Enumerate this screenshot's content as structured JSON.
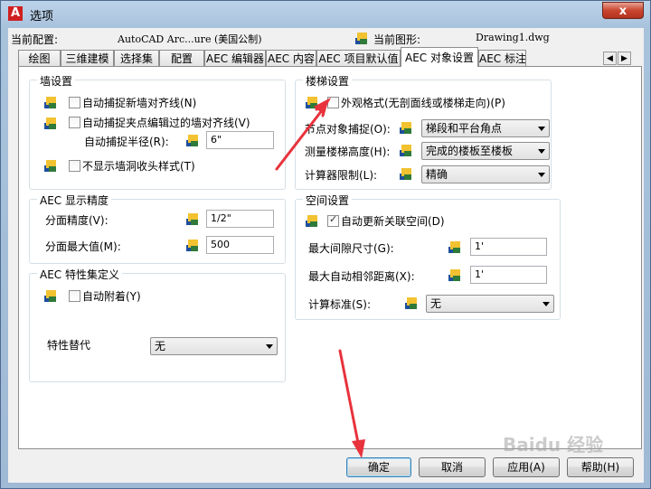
{
  "window": {
    "title": "选项",
    "app_icon": "A"
  },
  "profile": {
    "current_profile_label": "当前配置:",
    "current_profile_value": "AutoCAD Arc...ure (美国公制)",
    "current_drawing_label": "当前图形:",
    "current_drawing_value": "Drawing1.dwg"
  },
  "tabs": [
    "绘图",
    "三维建模",
    "选择集",
    "配置",
    "AEC 编辑器",
    "AEC 内容",
    "AEC 项目默认值",
    "AEC 对象设置",
    "AEC 标注"
  ],
  "active_tab": "AEC 对象设置",
  "wall": {
    "title": "墙设置",
    "autosnap_new": "自动捕捉新墙对齐线(N)",
    "autosnap_grip": "自动捕捉夹点编辑过的墙对齐线(V)",
    "radius_label": "自动捕捉半径(R):",
    "radius_value": "6\"",
    "no_cleanup": "不显示墙洞收头样式(T)"
  },
  "precision": {
    "title": "AEC 显示精度",
    "area_label": "分面精度(V):",
    "area_value": "1/2\"",
    "max_label": "分面最大值(M):",
    "max_value": "500"
  },
  "propset": {
    "title": "AEC 特性集定义",
    "auto_attach": "自动附着(Y)",
    "override_label": "特性替代",
    "override_value": "无"
  },
  "stair": {
    "title": "楼梯设置",
    "presentation": "外观格式(无剖面线或楼梯走向)(P)",
    "snap_label": "节点对象捕捉(O):",
    "snap_value": "梯段和平台角点",
    "measure_label": "测量楼梯高度(H):",
    "measure_value": "完成的楼板至楼板",
    "calc_label": "计算器限制(L):",
    "calc_value": "精确"
  },
  "space": {
    "title": "空间设置",
    "auto_update": "自动更新关联空间(D)",
    "max_gap_label": "最大间隙尺寸(G):",
    "max_gap_value": "1'",
    "max_adj_label": "最大自动相邻距离(X):",
    "max_adj_value": "1'",
    "calc_std_label": "计算标准(S):",
    "calc_std_value": "无"
  },
  "buttons": {
    "ok": "确定",
    "cancel": "取消",
    "apply": "应用(A)",
    "help": "帮助(H)"
  },
  "close_label": "x",
  "watermark": "Baidu 经验",
  "colors": {
    "annotation": "#e8323c",
    "accent": "#3c7fb1"
  }
}
